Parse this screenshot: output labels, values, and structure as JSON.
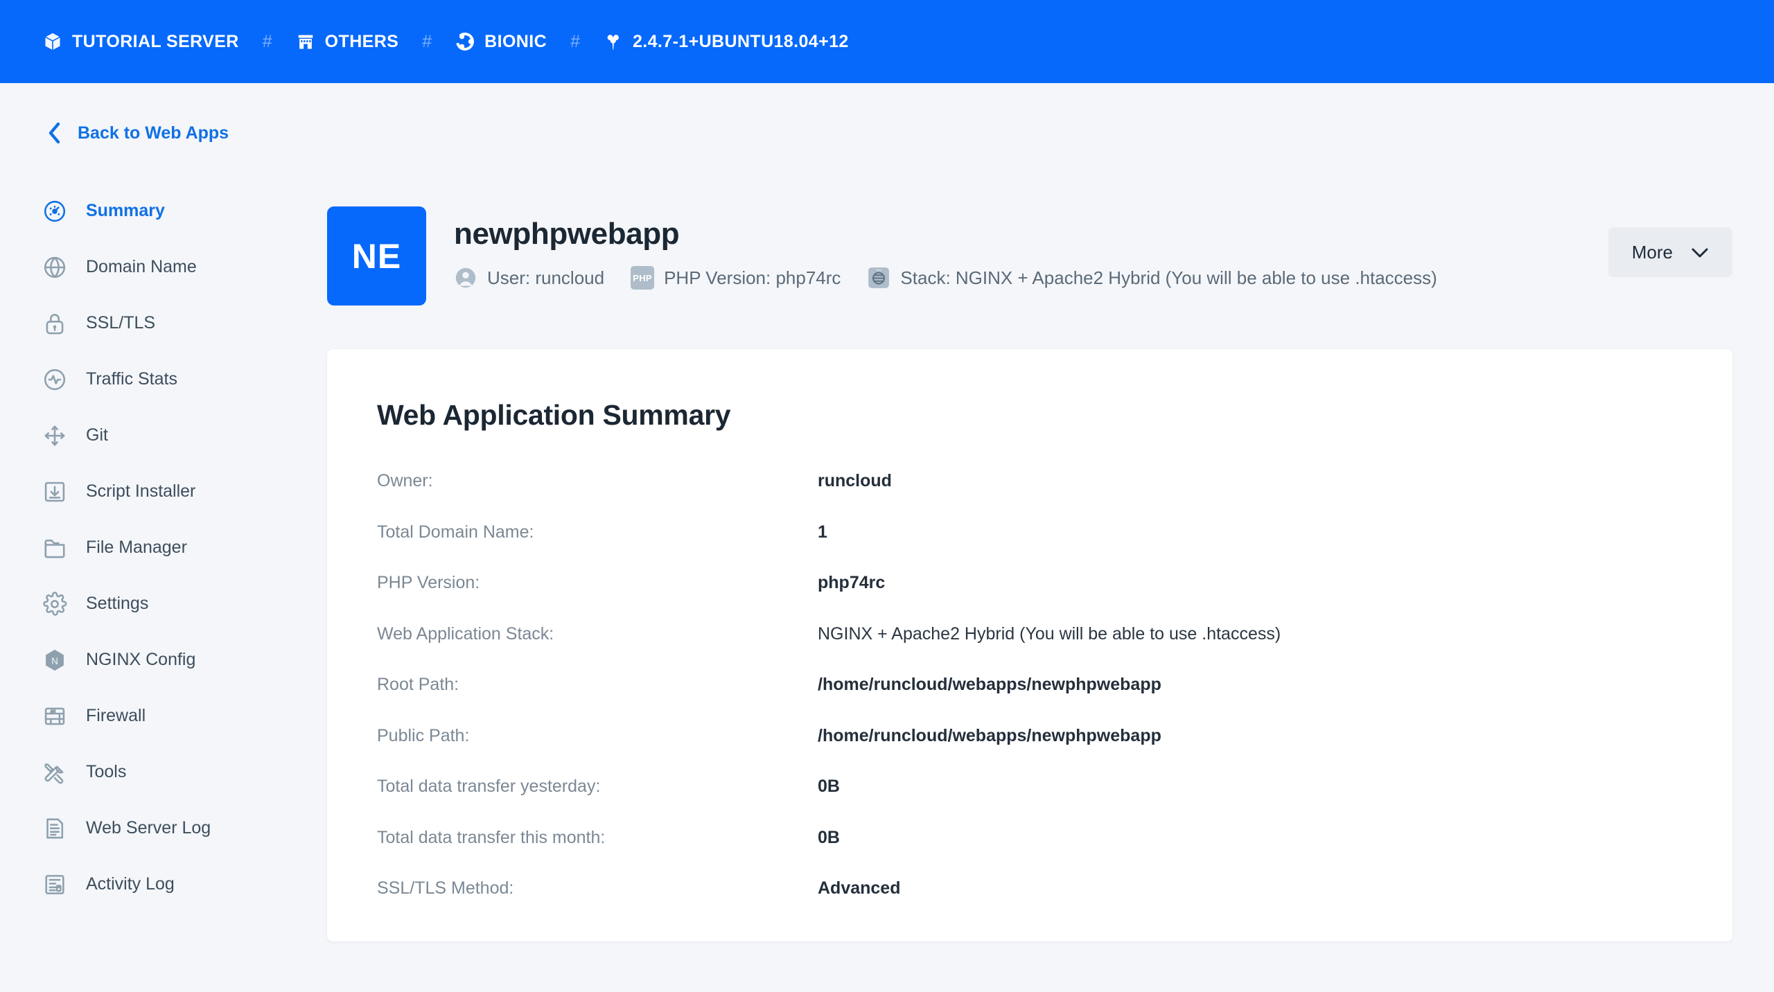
{
  "topbar": {
    "separator": "#",
    "crumbs": [
      {
        "icon": "cube-icon",
        "label": "TUTORIAL SERVER"
      },
      {
        "icon": "store-icon",
        "label": "OTHERS"
      },
      {
        "icon": "ubuntu-icon",
        "label": "BIONIC"
      },
      {
        "icon": "apache-icon",
        "label": "2.4.7-1+UBUNTU18.04+12"
      }
    ]
  },
  "sidebar": {
    "back_label": "Back to Web Apps",
    "items": [
      {
        "label": "Summary",
        "icon": "dashboard-icon",
        "active": true
      },
      {
        "label": "Domain Name",
        "icon": "globe-icon",
        "active": false
      },
      {
        "label": "SSL/TLS",
        "icon": "lock-icon",
        "active": false
      },
      {
        "label": "Traffic Stats",
        "icon": "pulse-icon",
        "active": false
      },
      {
        "label": "Git",
        "icon": "git-branch-icon",
        "active": false
      },
      {
        "label": "Script Installer",
        "icon": "download-box-icon",
        "active": false
      },
      {
        "label": "File Manager",
        "icon": "folder-icon",
        "active": false
      },
      {
        "label": "Settings",
        "icon": "gear-icon",
        "active": false
      },
      {
        "label": "NGINX Config",
        "icon": "nginx-hexagon-icon",
        "active": false
      },
      {
        "label": "Firewall",
        "icon": "firewall-icon",
        "active": false
      },
      {
        "label": "Tools",
        "icon": "tools-icon",
        "active": false
      },
      {
        "label": "Web Server Log",
        "icon": "document-lines-icon",
        "active": false
      },
      {
        "label": "Activity Log",
        "icon": "activity-doc-icon",
        "active": false
      }
    ]
  },
  "app_header": {
    "avatar_initials": "NE",
    "title": "newphpwebapp",
    "meta": [
      {
        "icon": "user-circle-icon",
        "badge": null,
        "text": "User: runcloud"
      },
      {
        "icon": null,
        "badge": "PHP",
        "text": "PHP Version: php74rc"
      },
      {
        "icon": "server-stack-icon",
        "badge": null,
        "text": "Stack: NGINX + Apache2 Hybrid (You will be able to use .htaccess)"
      }
    ],
    "more_label": "More",
    "more_icon": "chevron-down-icon"
  },
  "card": {
    "title": "Web Application Summary",
    "rows": [
      {
        "key": "Owner:",
        "value": "runcloud"
      },
      {
        "key": "Total Domain Name:",
        "value": "1"
      },
      {
        "key": "PHP Version:",
        "value": "php74rc"
      },
      {
        "key": "Web Application Stack:",
        "value": "NGINX + Apache2 Hybrid (You will be able to use .htaccess)"
      },
      {
        "key": "Root Path:",
        "value": "/home/runcloud/webapps/newphpwebapp"
      },
      {
        "key": "Public Path:",
        "value": "/home/runcloud/webapps/newphpwebapp"
      },
      {
        "key": "Total data transfer yesterday:",
        "value": "0B"
      },
      {
        "key": "Total data transfer this month:",
        "value": "0B"
      },
      {
        "key": "SSL/TLS Method:",
        "value": "Advanced"
      }
    ]
  },
  "colors": {
    "brand_blue": "#0669fb",
    "link_blue": "#1071e5",
    "page_bg": "#f4f6fa",
    "card_bg": "#ffffff",
    "muted_text": "#7b8894",
    "icon_gray": "#8ea0ad"
  }
}
